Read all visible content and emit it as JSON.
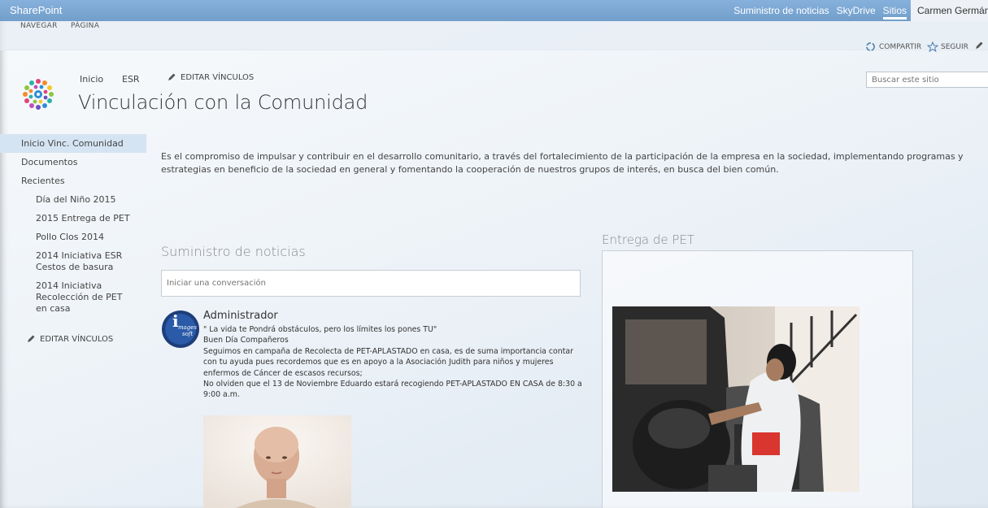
{
  "suite_bar": {
    "brand": "SharePoint",
    "links": [
      "Suministro de noticias",
      "SkyDrive",
      "Sitios"
    ],
    "user": "Carmen Germán",
    "bar_color": "#7ba7d4"
  },
  "ribbon": {
    "tabs": [
      "NAVEGAR",
      "PÁGINA"
    ],
    "share": "COMPARTIR",
    "follow": "SEGUIR"
  },
  "header": {
    "breadcrumb": [
      "Inicio",
      "ESR"
    ],
    "edit_links": "EDITAR VÍNCULOS",
    "title": "Vinculación con la Comunidad",
    "search_placeholder": "Buscar este sitio"
  },
  "left_nav": {
    "items": [
      "Inicio Vinc. Comunidad",
      "Documentos",
      "Recientes"
    ],
    "recent": [
      "Día del Niño 2015",
      "2015 Entrega de PET",
      "Pollo Clos 2014",
      "2014 Iniciativa ESR Cestos de basura",
      "2014 Iniciativa Recolección de PET en casa"
    ],
    "edit_links": "EDITAR VÍNCULOS"
  },
  "main": {
    "intro": "Es el compromiso de impulsar y contribuir en el desarrollo comunitario, a través del fortalecimiento de la participación de la empresa en la sociedad, implementando programas y estrategias en beneficio de la sociedad en general y fomentando la cooperación de nuestros grupos de interés, en busca del bien común.",
    "feed_title": "Suministro de noticias",
    "feed_placeholder": "Iniciar una conversación",
    "post": {
      "author": "Administrador",
      "logo_text": "images soft",
      "lines": [
        "\" La vida te Pondrá obstáculos, pero los límites los pones TU\"",
        "Buen Día Compañeros",
        "Seguimos en campaña de Recolecta de PET-APLASTADO en casa, es de suma importancia contar con tu ayuda pues recordemos que es en apoyo a la Asociación Judith para niños y mujeres enfermos de Cáncer de escasos recursos;",
        "No olviden que el 13 de Noviembre Eduardo estará recogiendo PET-APLASTADO EN CASA de 8:30 a 9:00 a.m."
      ]
    },
    "pet_title": "Entrega de PET"
  }
}
